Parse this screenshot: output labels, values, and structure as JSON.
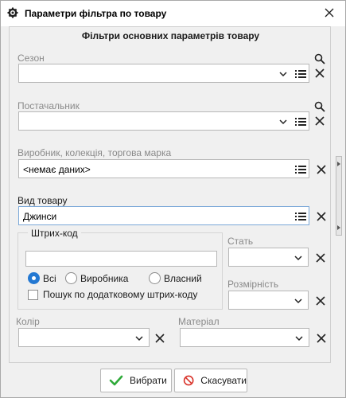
{
  "window": {
    "title": "Параметри фільтра по товару",
    "icon": "gear-icon"
  },
  "panel": {
    "header": "Фільтри основних параметрів товару"
  },
  "season": {
    "label": "Сезон",
    "value": ""
  },
  "supplier": {
    "label": "Постачальник",
    "value": ""
  },
  "manufacturer": {
    "label": "Виробник, колекція, торгова марка",
    "value": "<немає даних>"
  },
  "product_type": {
    "label": "Вид товару",
    "value": "Джинси"
  },
  "barcode": {
    "group_title": "Штрих-код",
    "value": "",
    "options": [
      "Всі",
      "Виробника",
      "Власний"
    ],
    "selected": "Всі",
    "extra_search_label": "Пошук по додатковому штрих-коду",
    "extra_search_checked": false
  },
  "gender": {
    "label": "Стать",
    "value": ""
  },
  "size": {
    "label": "Розмірність",
    "value": ""
  },
  "color": {
    "label": "Колір",
    "value": ""
  },
  "material": {
    "label": "Матеріал",
    "value": ""
  },
  "buttons": {
    "select_label": "Вибрати",
    "cancel_label": "Скасувати"
  },
  "colors": {
    "accent": "#2378d2",
    "ok_check": "#2faa3a",
    "cancel_red": "#d9342b"
  }
}
